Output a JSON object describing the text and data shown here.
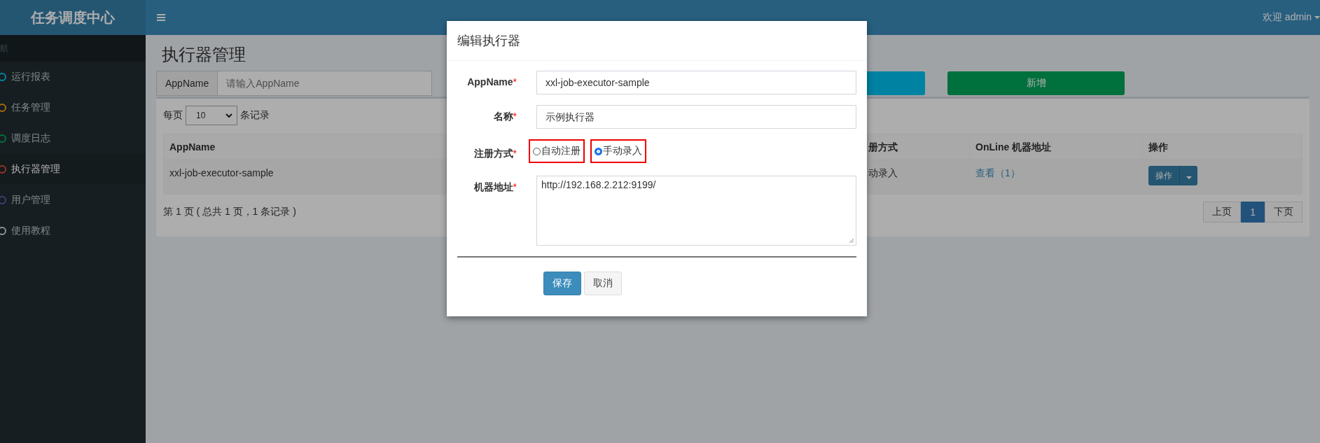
{
  "brand": "任务调度中心",
  "header": {
    "user": "欢迎 admin"
  },
  "sidebar": {
    "heading": "航",
    "items": [
      {
        "label": "运行报表",
        "color": "#0083a3",
        "selected": false
      },
      {
        "label": "任务管理",
        "color": "#a56a0c",
        "selected": false
      },
      {
        "label": "调度日志",
        "color": "#00713d",
        "selected": false
      },
      {
        "label": "执行器管理",
        "color": "#963327",
        "selected": true
      },
      {
        "label": "用户管理",
        "color": "#413e72",
        "selected": false
      },
      {
        "label": "使用教程",
        "color": "#8f9197",
        "selected": false
      }
    ]
  },
  "page": {
    "title": "执行器管理",
    "search": {
      "label": "AppName",
      "placeholder": "请输入AppName"
    },
    "add_button": "新增",
    "page_size": {
      "prefix": "每页",
      "value": "10",
      "suffix": "条记录"
    },
    "table": {
      "columns": [
        "AppName",
        "册方式",
        "OnLine 机器地址",
        "操作"
      ],
      "rows": [
        {
          "appname": "xxl-job-executor-sample",
          "reg": "动录入",
          "link": "查看（1）",
          "action": "操作"
        }
      ]
    },
    "summary": "第 1 页 ( 总共 1 页，1 条记录 )",
    "pagination": [
      {
        "label": "上页",
        "selected": false
      },
      {
        "label": "1",
        "selected": true
      },
      {
        "label": "下页",
        "selected": false
      }
    ]
  },
  "modal": {
    "title": "编辑执行器",
    "fields": [
      {
        "kind": "text",
        "label": "AppName",
        "mark": "*",
        "value": "xxl-job-executor-sample"
      },
      {
        "kind": "text",
        "label": "名称",
        "mark": "*",
        "value": "示例执行器"
      },
      {
        "kind": "radio",
        "label": "注册方式",
        "mark": "*",
        "options": [
          {
            "label": "自动注册",
            "selected": false,
            "highlighted": true
          },
          {
            "label": "手动录入",
            "selected": true,
            "highlighted": true
          }
        ]
      },
      {
        "kind": "textarea",
        "label": "机器地址",
        "mark": "*",
        "value": "http://192.168.2.212:9199/"
      }
    ],
    "buttons": [
      {
        "kind": "primary",
        "label": "保存"
      },
      {
        "kind": "default",
        "label": "取消"
      }
    ]
  }
}
